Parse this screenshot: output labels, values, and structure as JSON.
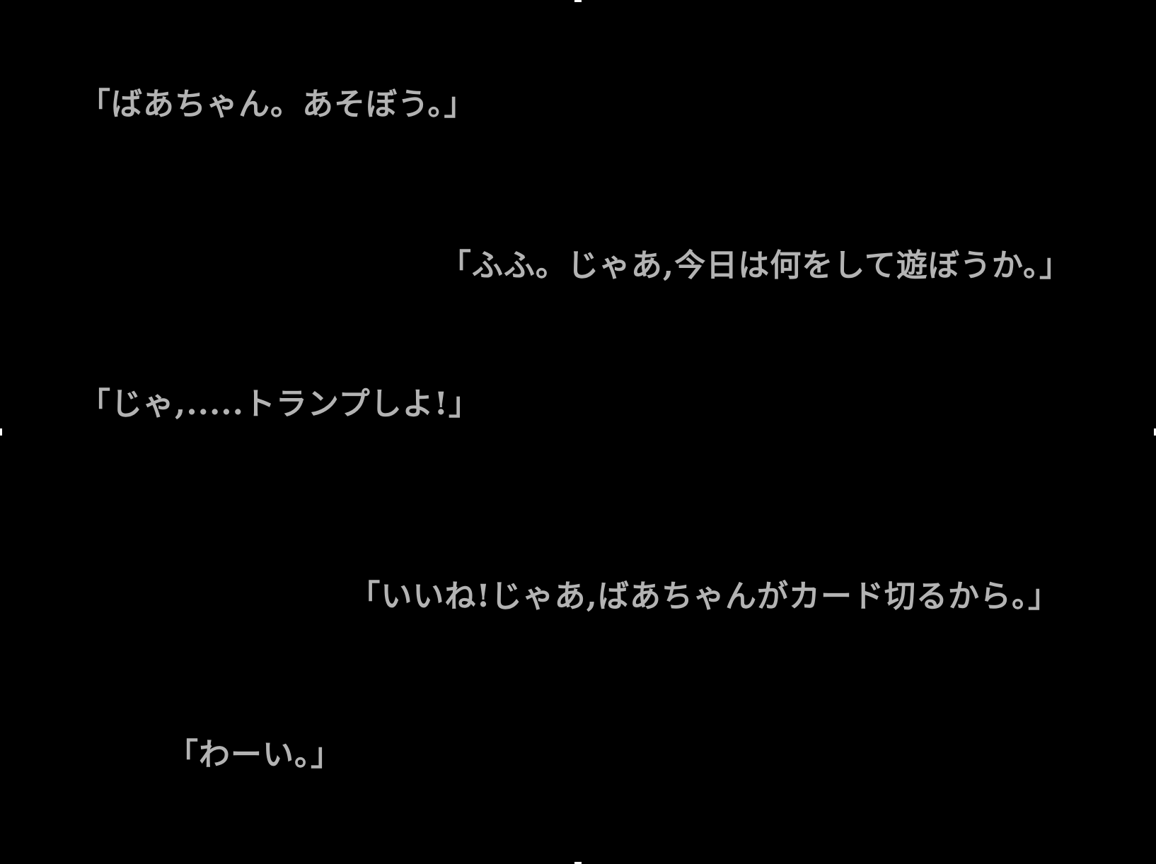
{
  "colors": {
    "background": "#000000",
    "dialogue_text": "#b3b3b3",
    "handle": "#ffffff"
  },
  "dialogue": [
    {
      "speaker_side": "left",
      "text": "「ばあちゃん。あそぼう。」"
    },
    {
      "speaker_side": "right",
      "text": "「ふふ。じゃあ,今日は何をして遊ぼうか。」"
    },
    {
      "speaker_side": "left",
      "text": "「じゃ,.....トランプしよ!」"
    },
    {
      "speaker_side": "right",
      "text": "「いいね!じゃあ,ばあちゃんがカード切るから。」"
    },
    {
      "speaker_side": "left",
      "text": "「わーい。」"
    }
  ]
}
